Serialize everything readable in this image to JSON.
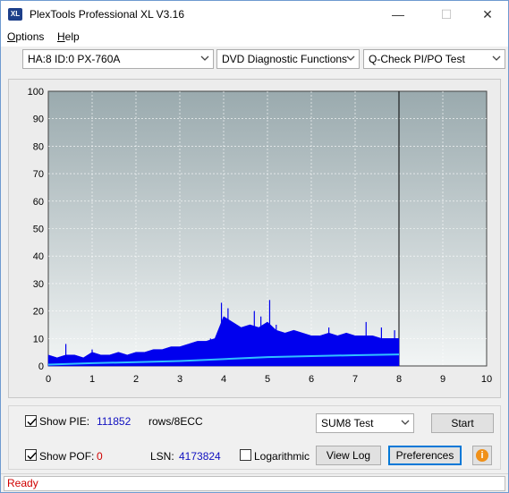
{
  "window": {
    "title": "PlexTools Professional XL V3.16",
    "icon_text": "XL",
    "minimize": "—",
    "maximize": "☐",
    "close": "✕"
  },
  "menu": {
    "options_prefix": "O",
    "options_rest": "ptions",
    "help_prefix": "H",
    "help_rest": "elp"
  },
  "toolbar": {
    "drive": "HA:8 ID:0  PX-760A",
    "function": "DVD Diagnostic Functions",
    "test": "Q-Check PI/PO Test"
  },
  "chart_data": {
    "type": "area",
    "x_ticks": [
      "0",
      "1",
      "2",
      "3",
      "4",
      "5",
      "6",
      "7",
      "8",
      "9",
      "10"
    ],
    "y_ticks": [
      "100",
      "90",
      "80",
      "70",
      "60",
      "50",
      "40",
      "30",
      "20",
      "10",
      "0"
    ],
    "xlim": [
      0,
      10
    ],
    "ylim": [
      0,
      100
    ],
    "grid": true,
    "scan_end_x": 8,
    "series": [
      {
        "color": "#0000ee",
        "x": [
          0.0,
          0.2,
          0.4,
          0.6,
          0.8,
          1.0,
          1.2,
          1.4,
          1.6,
          1.8,
          2.0,
          2.2,
          2.4,
          2.6,
          2.8,
          3.0,
          3.2,
          3.4,
          3.6,
          3.8,
          3.9,
          4.0,
          4.2,
          4.4,
          4.6,
          4.8,
          5.0,
          5.2,
          5.4,
          5.6,
          5.8,
          6.0,
          6.2,
          6.4,
          6.6,
          6.8,
          7.0,
          7.2,
          7.4,
          7.6,
          7.8,
          8.0
        ],
        "values": [
          4,
          3,
          4,
          4,
          3,
          5,
          4,
          4,
          5,
          4,
          5,
          5,
          6,
          6,
          7,
          7,
          8,
          9,
          9,
          10,
          14,
          18,
          16,
          14,
          15,
          14,
          16,
          13,
          12,
          13,
          12,
          11,
          11,
          12,
          11,
          12,
          11,
          11,
          11,
          10,
          10,
          10
        ]
      },
      {
        "color": "#30c0ff",
        "x": [
          0,
          1,
          2,
          3,
          4,
          5,
          6,
          7,
          8
        ],
        "values": [
          0.5,
          1.0,
          1.4,
          1.8,
          2.5,
          3.2,
          3.6,
          3.9,
          4.2
        ]
      }
    ]
  },
  "controls": {
    "show_pie_label": "Show PIE:",
    "pie_value": "111852",
    "pie_unit": "rows/8ECC",
    "show_pof_label": "Show POF:",
    "pof_value": "0",
    "lsn_label": "LSN:",
    "lsn_value": "4173824",
    "logarithmic_label": "Logarithmic",
    "sum_test": "SUM8 Test",
    "start_label": "Start",
    "view_log_label": "View Log",
    "preferences_label": "Preferences",
    "info_icon_text": "i"
  },
  "status": {
    "text": "Ready"
  }
}
